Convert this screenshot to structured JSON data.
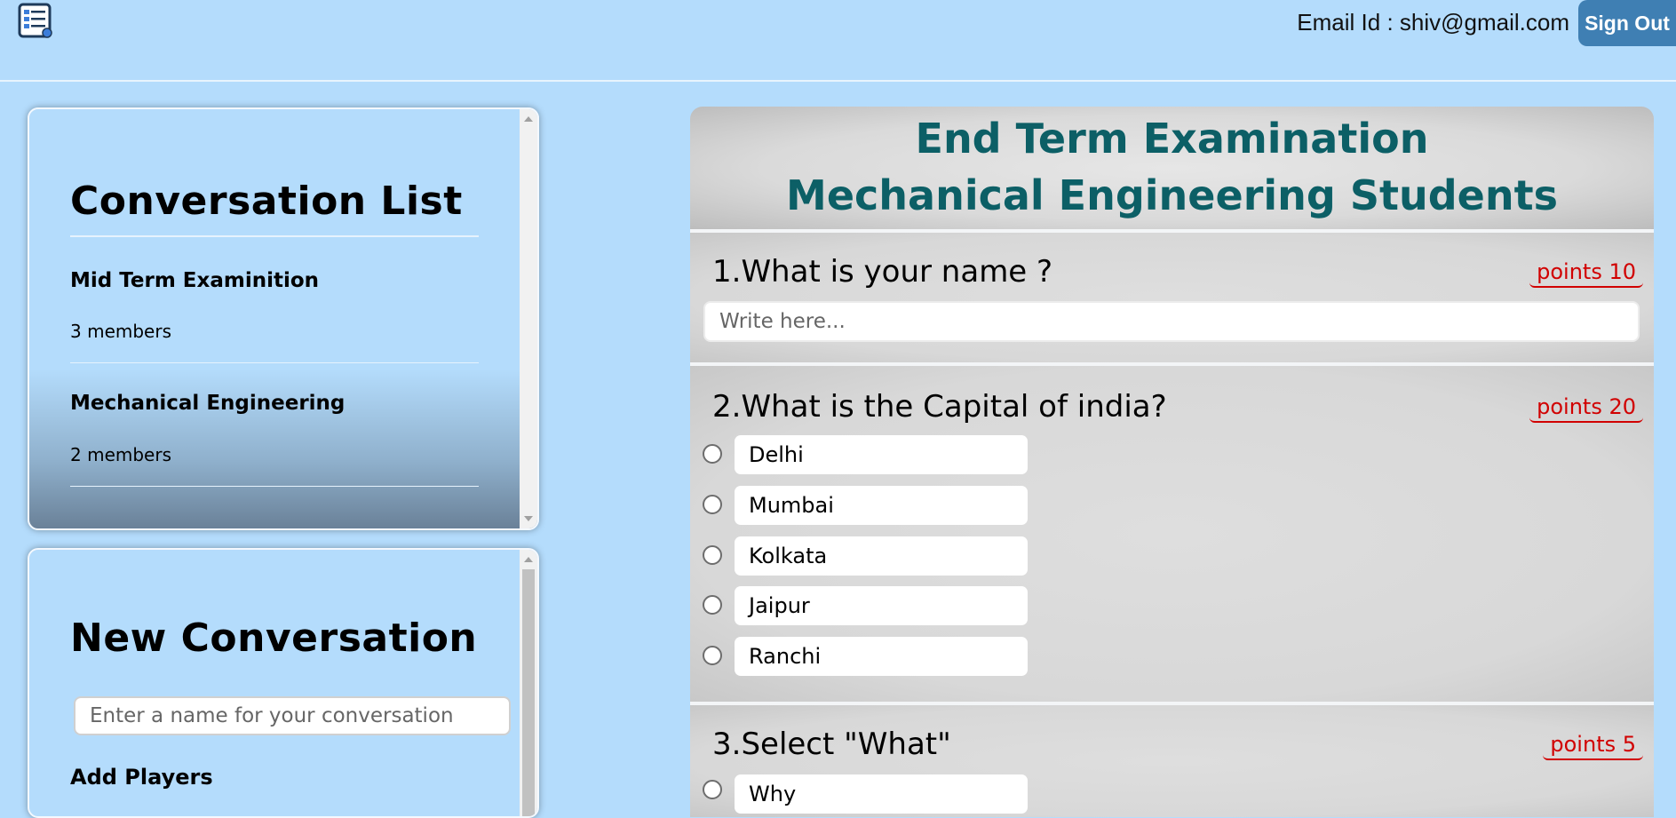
{
  "header": {
    "logo_icon": "document-list-icon",
    "email_label": "Email Id : shiv@gmail.com",
    "signout_label": "Sign Out",
    "signout_color": "#3f7fb3"
  },
  "conversation_list": {
    "title": "Conversation List",
    "items": [
      {
        "name": "Mid Term Examinition",
        "members": "3 members"
      },
      {
        "name": "Mechanical Engineering",
        "members": "2 members"
      }
    ]
  },
  "new_conversation": {
    "title": "New Conversation",
    "name_placeholder": "Enter a name for your conversation",
    "add_players_label": "Add Players"
  },
  "exam": {
    "title_line1": "End Term Examination",
    "title_line2": "Mechanical Engineering Students",
    "title_color": "#0c5f66",
    "points_color": "#d10000",
    "questions": [
      {
        "title": "1.What is your name ?",
        "points": "points 10",
        "answer_placeholder": "Write here..."
      },
      {
        "title": "2.What is the Capital of india?",
        "points": "points 20",
        "options": [
          "Delhi",
          "Mumbai",
          "Kolkata",
          "Jaipur",
          "Ranchi"
        ]
      },
      {
        "title": "3.Select \"What\"",
        "points": "points 5",
        "options": [
          "Why"
        ]
      }
    ]
  }
}
